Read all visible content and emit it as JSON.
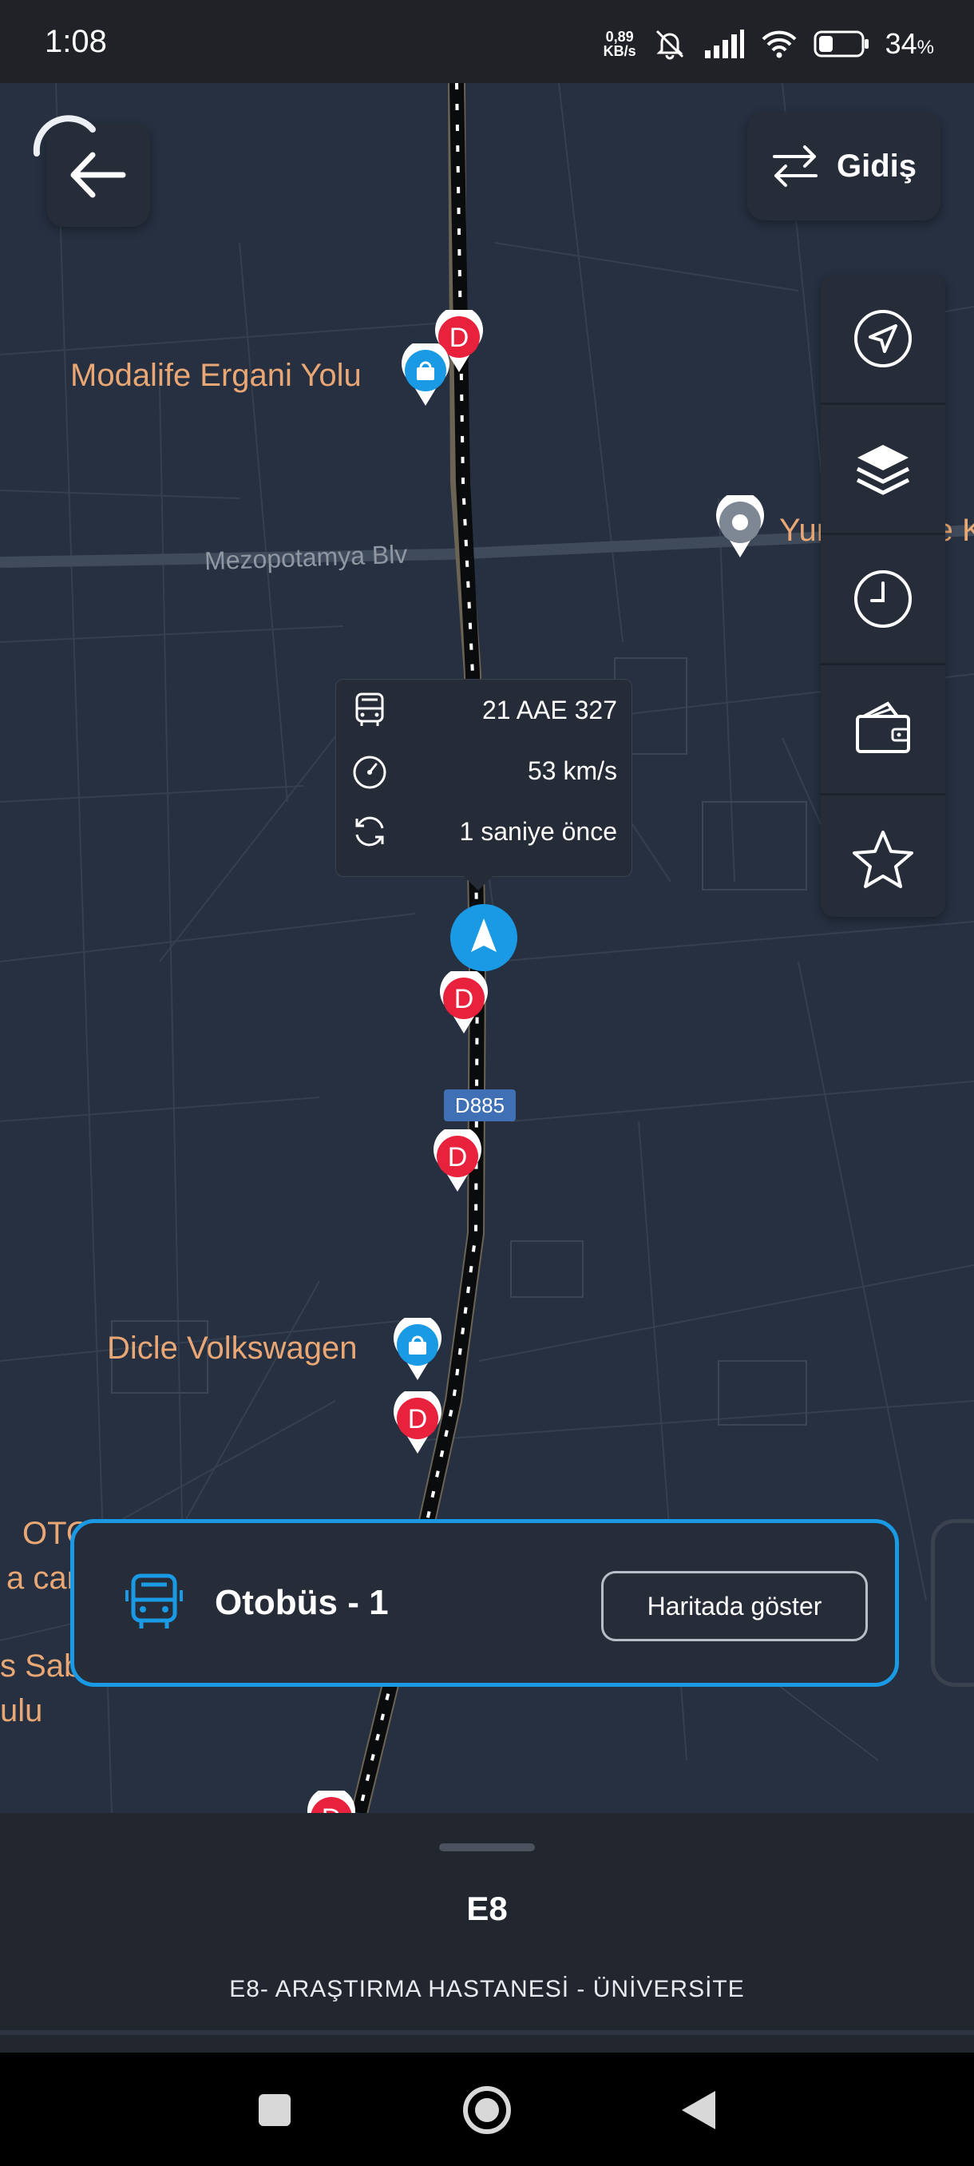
{
  "status_bar": {
    "time": "1:08",
    "net_speed_value": "0,89",
    "net_speed_unit": "KB/s",
    "battery_percent": "34",
    "battery_suffix": "%",
    "battery_level": 0.34
  },
  "header": {
    "direction_label": "Gidiş"
  },
  "map": {
    "street_name": "Mezopotamya Blv",
    "road_badge": "D885",
    "poi_labels": {
      "modalife": "Modalife Ergani Yolu",
      "yunus_partial": "Yunus Emre Kongo",
      "dicle": "Dicle Volkswagen",
      "otosec_line1": "OTO SEÇ Diyarbakır",
      "otosec_line2": "a car araç kiralama...",
      "left_partial_line1": "s Sab",
      "left_partial_line2": "ulu"
    },
    "stop_letter": "D"
  },
  "vehicle_info": {
    "plate": "21 AAE 327",
    "speed": "53 km/s",
    "updated": "1 saniye önce"
  },
  "bus_card": {
    "title": "Otobüs - 1",
    "show_button": "Haritada göster"
  },
  "bottom_sheet": {
    "line_code": "E8",
    "route_name": "E8- ARAŞTIRMA HASTANESİ - ÜNİVERSİTE"
  },
  "colors": {
    "accent_blue": "#1a9ae4",
    "stop_red": "#e8223d",
    "poi_orange": "#e8a774",
    "map_bg": "#263040"
  }
}
